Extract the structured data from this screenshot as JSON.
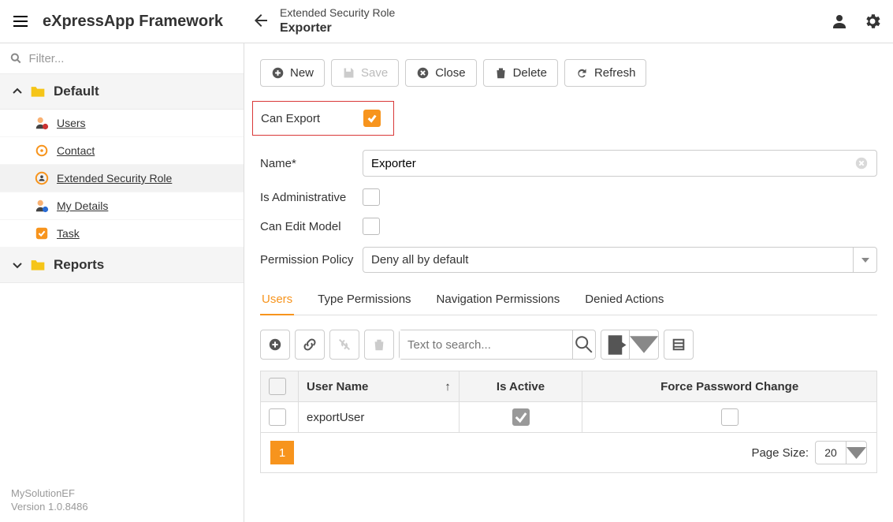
{
  "header": {
    "brand": "eXpressApp Framework",
    "breadcrumb": "Extended Security Role",
    "title": "Exporter"
  },
  "sidebar": {
    "filter_placeholder": "Filter...",
    "groups": [
      {
        "label": "Default",
        "expanded": true
      },
      {
        "label": "Reports",
        "expanded": false
      }
    ],
    "items": [
      {
        "label": "Users",
        "active": false
      },
      {
        "label": "Contact",
        "active": false
      },
      {
        "label": "Extended Security Role",
        "active": true
      },
      {
        "label": "My Details",
        "active": false
      },
      {
        "label": "Task",
        "active": false
      }
    ],
    "meta1": "MySolutionEF",
    "meta2": "Version 1.0.8486"
  },
  "toolbar": {
    "new_label": "New",
    "save_label": "Save",
    "close_label": "Close",
    "delete_label": "Delete",
    "refresh_label": "Refresh"
  },
  "fields": {
    "can_export_label": "Can Export",
    "can_export_checked": true,
    "name_label": "Name*",
    "name_value": "Exporter",
    "is_admin_label": "Is Administrative",
    "can_edit_model_label": "Can Edit Model",
    "permission_policy_label": "Permission Policy",
    "permission_policy_value": "Deny all by default"
  },
  "tabs": [
    {
      "label": "Users",
      "active": true
    },
    {
      "label": "Type Permissions",
      "active": false
    },
    {
      "label": "Navigation Permissions",
      "active": false
    },
    {
      "label": "Denied Actions",
      "active": false
    }
  ],
  "users_grid": {
    "search_placeholder": "Text to search...",
    "columns": {
      "user_name": "User Name",
      "is_active": "Is Active",
      "force_pw": "Force Password Change"
    },
    "rows": [
      {
        "user_name": "exportUser",
        "is_active": true,
        "force_pw": false
      }
    ],
    "page_current": "1",
    "page_size_label": "Page Size:",
    "page_size_value": "20"
  }
}
